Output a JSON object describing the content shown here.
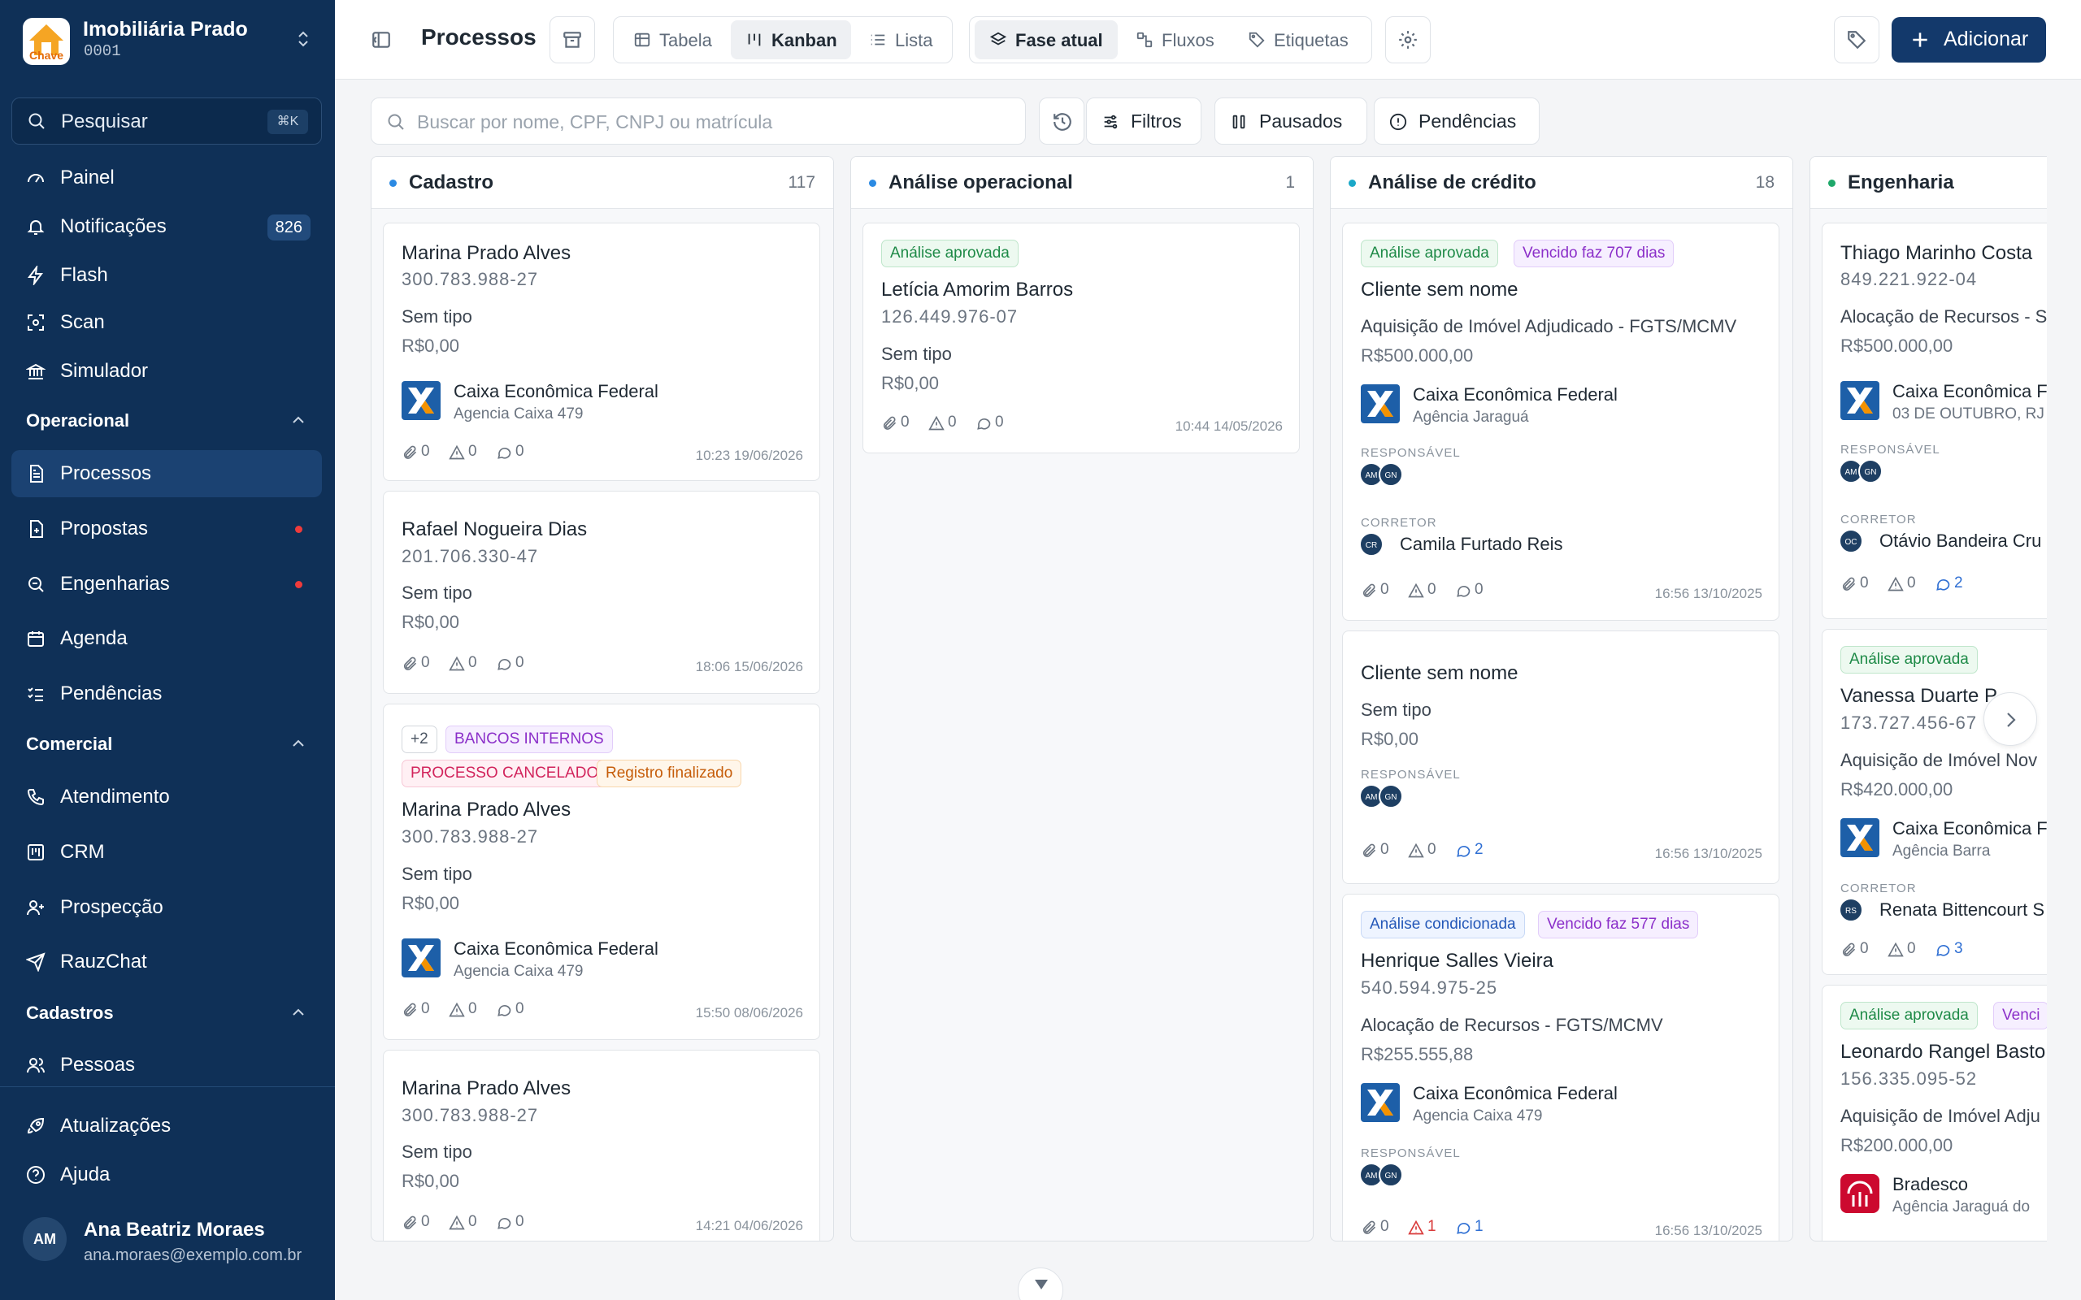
{
  "app": {
    "name": "Imobiliária Prado",
    "code": "0001",
    "logo_text": "Chave"
  },
  "colors": {
    "sidebar": "#0f3057",
    "primary": "#13396b",
    "caixa_blue": "#1d5fa8",
    "caixa_orange": "#f39200",
    "bradesco": "#cc092f"
  },
  "sidebar": {
    "search_label": "Pesquisar",
    "search_shortcut": "⌘K",
    "items": [
      {
        "label": "Painel",
        "icon": "gauge-icon"
      },
      {
        "label": "Notificações",
        "icon": "bell-icon",
        "badge": "826"
      },
      {
        "label": "Flash",
        "icon": "lightning-icon"
      },
      {
        "label": "Scan",
        "icon": "scan-icon"
      },
      {
        "label": "Simulador",
        "icon": "bank-icon"
      }
    ],
    "sections": [
      {
        "label": "Operacional",
        "items": [
          {
            "label": "Processos",
            "icon": "document-icon",
            "active": true
          },
          {
            "label": "Propostas",
            "icon": "file-plus-icon",
            "dot": true
          },
          {
            "label": "Engenharias",
            "icon": "search-doc-icon",
            "dot": true
          },
          {
            "label": "Agenda",
            "icon": "calendar-icon"
          },
          {
            "label": "Pendências",
            "icon": "list-check-icon"
          }
        ]
      },
      {
        "label": "Comercial",
        "items": [
          {
            "label": "Atendimento",
            "icon": "phone-icon"
          },
          {
            "label": "CRM",
            "icon": "kanban-icon"
          },
          {
            "label": "Prospecção",
            "icon": "user-plus-icon"
          },
          {
            "label": "RauzChat",
            "icon": "send-icon"
          }
        ]
      },
      {
        "label": "Cadastros",
        "items": [
          {
            "label": "Pessoas",
            "icon": "users-icon"
          }
        ]
      }
    ],
    "footer": [
      {
        "label": "Atualizações",
        "icon": "rocket-icon"
      },
      {
        "label": "Ajuda",
        "icon": "help-icon"
      }
    ],
    "user": {
      "initials": "AM",
      "name": "Ana Beatriz Moraes",
      "email": "ana.moraes@exemplo.com.br"
    }
  },
  "header": {
    "title": "Processos",
    "views": [
      "Tabela",
      "Kanban",
      "Lista"
    ],
    "active_view": "Kanban",
    "groupings": [
      "Fase atual",
      "Fluxos",
      "Etiquetas"
    ],
    "active_grouping": "Fase atual",
    "add_label": "Adicionar"
  },
  "filters": {
    "search_placeholder": "Buscar por nome, CPF, CNPJ ou matrícula",
    "buttons": [
      "Filtros",
      "Pausados",
      "Pendências"
    ]
  },
  "meta_labels": {
    "responsible": "RESPONSÁVEL",
    "broker": "CORRETOR"
  },
  "columns": [
    {
      "title": "Cadastro",
      "count": "117",
      "dot": "#2b8ae3",
      "cards": [
        {
          "name": "Marina Prado Alves",
          "doc": "300.783.988-27",
          "type": "Sem tipo",
          "value": "R$0,00",
          "bank": "Caixa Econômica Federal",
          "agency": "Agencia Caixa 479",
          "attach": "0",
          "alerts": "0",
          "comments": "0",
          "time": "10:23 19/06/2026"
        },
        {
          "name": "Rafael Nogueira Dias",
          "doc": "201.706.330-47",
          "type": "Sem tipo",
          "value": "R$0,00",
          "attach": "0",
          "alerts": "0",
          "comments": "0",
          "time": "18:06 15/06/2026"
        },
        {
          "tags": [
            "+2",
            "BANCOS INTERNOS",
            "PROCESSO CANCELADO",
            "Registro finalizado"
          ],
          "name": "Marina Prado Alves",
          "doc": "300.783.988-27",
          "type": "Sem tipo",
          "value": "R$0,00",
          "bank": "Caixa Econômica Federal",
          "agency": "Agencia Caixa 479",
          "attach": "0",
          "alerts": "0",
          "comments": "0",
          "time": "15:50 08/06/2026"
        },
        {
          "name": "Marina Prado Alves",
          "doc": "300.783.988-27",
          "type": "Sem tipo",
          "value": "R$0,00",
          "attach": "0",
          "alerts": "0",
          "comments": "0",
          "time": "14:21 04/06/2026"
        }
      ]
    },
    {
      "title": "Análise operacional",
      "count": "1",
      "dot": "#2b8ae3",
      "cards": [
        {
          "tags": [
            "Análise aprovada"
          ],
          "name": "Letícia Amorim Barros",
          "doc": "126.449.976-07",
          "type": "Sem tipo",
          "value": "R$0,00",
          "attach": "0",
          "alerts": "0",
          "comments": "0",
          "time": "10:44 14/05/2026"
        }
      ]
    },
    {
      "title": "Análise de crédito",
      "count": "18",
      "dot": "#1aa8c8",
      "cards": [
        {
          "tags": [
            "Análise aprovada",
            "Vencido faz 707 dias"
          ],
          "name": "Cliente sem nome",
          "type": "Aquisição de Imóvel Adjudicado - FGTS/MCMV",
          "value": "R$500.000,00",
          "bank": "Caixa Econômica Federal",
          "agency": "Agência Jaraguá",
          "responsible": [
            "AM",
            "GN"
          ],
          "broker_initials": "CR",
          "broker": "Camila Furtado Reis",
          "attach": "0",
          "alerts": "0",
          "comments": "0",
          "time": "16:56 13/10/2025"
        },
        {
          "name": "Cliente sem nome",
          "type": "Sem tipo",
          "value": "R$0,00",
          "responsible": [
            "AM",
            "GN"
          ],
          "attach": "0",
          "alerts": "0",
          "comments": "2",
          "time": "16:56 13/10/2025"
        },
        {
          "tags": [
            "Análise condicionada",
            "Vencido faz 577 dias"
          ],
          "name": "Henrique Salles Vieira",
          "doc": "540.594.975-25",
          "type": "Alocação de Recursos - FGTS/MCMV",
          "value": "R$255.555,88",
          "bank": "Caixa Econômica Federal",
          "agency": "Agencia Caixa 479",
          "responsible": [
            "AM",
            "GN"
          ],
          "attach": "0",
          "alerts": "1",
          "comments": "1",
          "time": "16:56 13/10/2025"
        }
      ]
    },
    {
      "title": "Engenharia",
      "count": "",
      "dot": "#1fa86a",
      "cards": [
        {
          "name": "Thiago Marinho Costa",
          "doc": "849.221.922-04",
          "type": "Alocação de Recursos - S",
          "value": "R$500.000,00",
          "bank": "Caixa Econômica F",
          "agency": "03 DE OUTUBRO, RJ",
          "responsible": [
            "AM",
            "GN"
          ],
          "broker_initials": "OC",
          "broker": "Otávio Bandeira Cru",
          "attach": "0",
          "alerts": "0",
          "comments": "2"
        },
        {
          "tags": [
            "Análise aprovada"
          ],
          "name": "Vanessa Duarte P",
          "doc": "173.727.456-67",
          "type": "Aquisição de Imóvel Nov",
          "value": "R$420.000,00",
          "bank": "Caixa Econômica F",
          "agency": "Agência Barra",
          "broker_initials": "RS",
          "broker": "Renata Bittencourt S",
          "attach": "0",
          "alerts": "0",
          "comments": "3"
        },
        {
          "tags": [
            "Análise aprovada",
            "Venci"
          ],
          "name": "Leonardo Rangel Basto",
          "doc": "156.335.095-52",
          "type": "Aquisição de Imóvel Adju",
          "value": "R$200.000,00",
          "bank": "Bradesco",
          "agency": "Agência Jaraguá do"
        }
      ]
    }
  ]
}
